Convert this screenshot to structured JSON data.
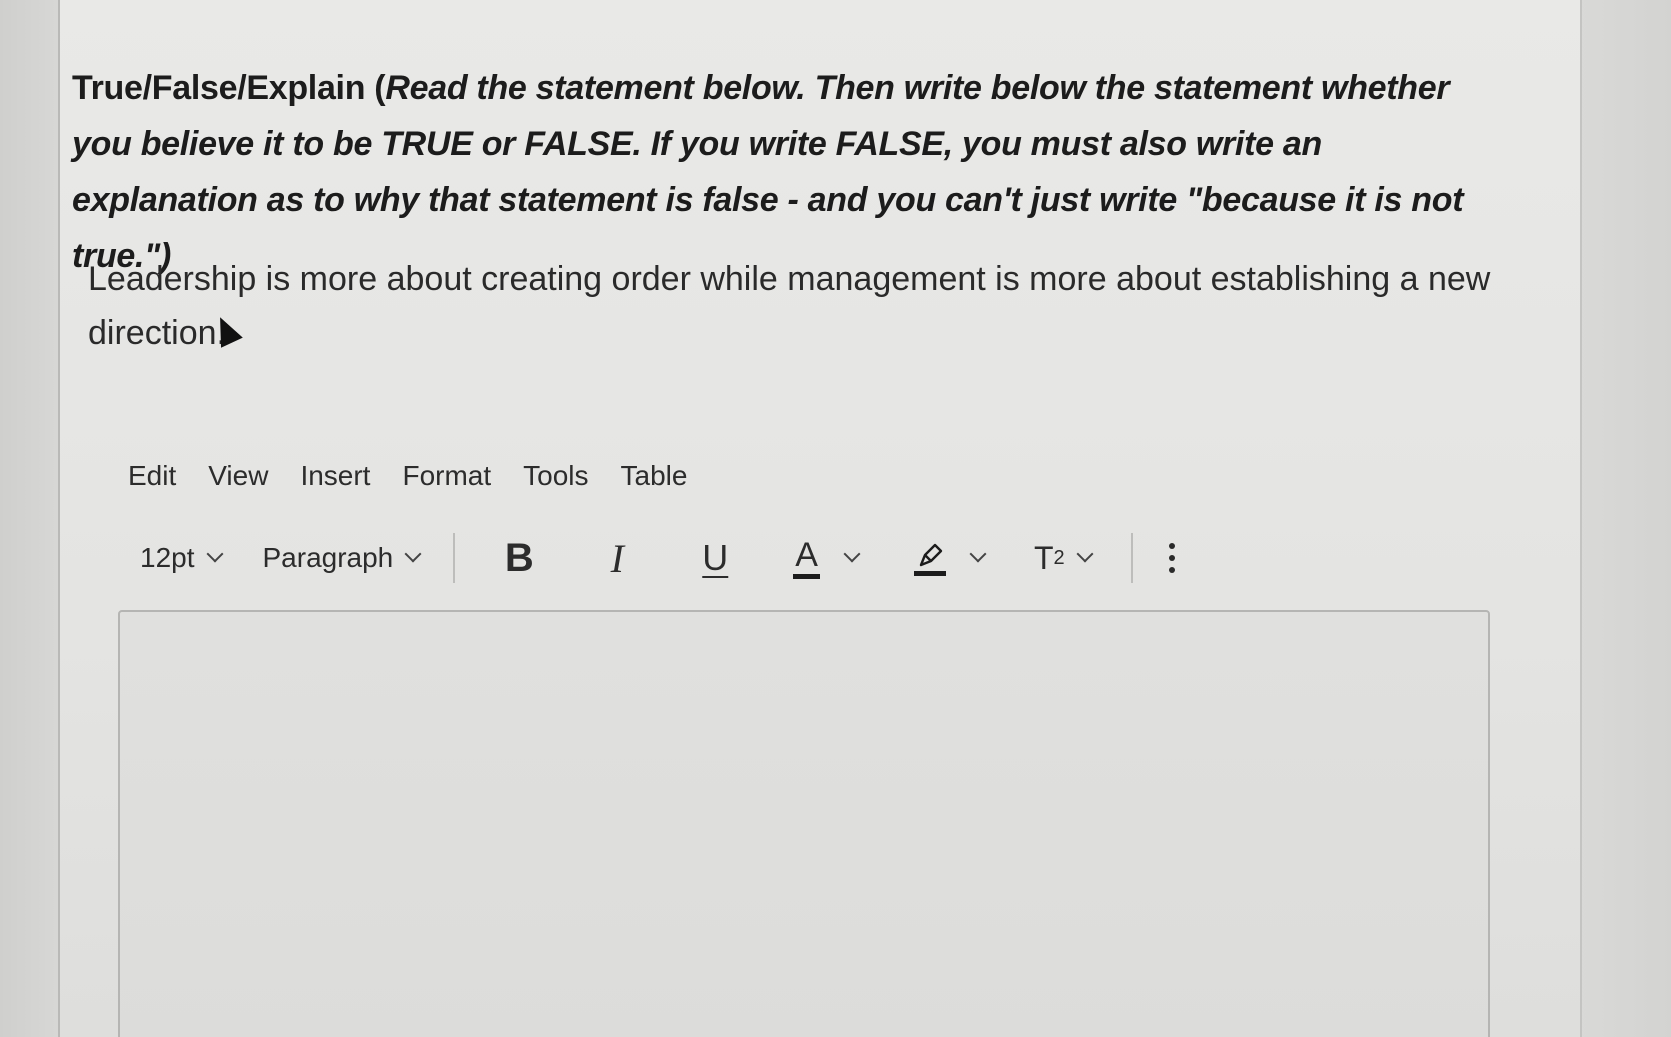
{
  "question": {
    "instructions_lead": "True/False/Explain (",
    "instructions_rest": "Read the statement below.  Then write below the statement whether you believe it to be TRUE or FALSE.  If you write FALSE, you must also write an explanation as to why that statement is false - and you can't just write \"because it is not true.\")",
    "statement": "Leadership is more about creating order while management is more about establishing a new direction."
  },
  "menubar": {
    "items": [
      "Edit",
      "View",
      "Insert",
      "Format",
      "Tools",
      "Table"
    ]
  },
  "toolbar": {
    "font_size": "12pt",
    "block_format": "Paragraph",
    "bold_label": "B",
    "italic_label": "I",
    "underline_label": "U",
    "text_color_label": "A",
    "superscript_base": "T",
    "superscript_exp": "2"
  },
  "editor": {
    "value": ""
  }
}
